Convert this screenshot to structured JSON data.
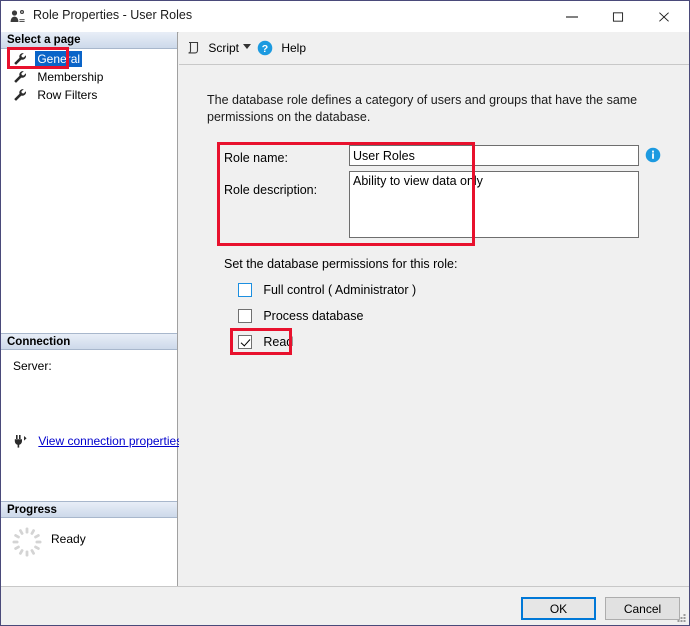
{
  "window": {
    "title": "Role Properties - User Roles",
    "icon": "role-users-icon",
    "controls": {
      "minimize": "minimize-icon",
      "maximize": "maximize-icon",
      "close": "close-icon"
    }
  },
  "sidebar": {
    "sections": {
      "select_page": "Select a page",
      "connection": "Connection",
      "progress": "Progress"
    },
    "pages": [
      {
        "label": "General",
        "icon": "wrench-icon",
        "selected": true
      },
      {
        "label": "Membership",
        "icon": "wrench-icon",
        "selected": false
      },
      {
        "label": "Row Filters",
        "icon": "wrench-icon",
        "selected": false
      }
    ],
    "connection": {
      "server_label": "Server:",
      "server_value": "",
      "link_label": "View connection properties",
      "link_icon": "plug-icon"
    },
    "progress": {
      "status": "Ready",
      "icon": "spinner-icon"
    }
  },
  "toolbar": {
    "script_label": "Script",
    "script_icon": "script-icon",
    "script_caret": "chevron-down-icon",
    "help_label": "Help",
    "help_icon": "help-question-icon"
  },
  "main": {
    "description": "The database role defines a category of users and groups that have the same permissions on the database.",
    "fields": {
      "role_name_label": "Role name:",
      "role_name_value": "User Roles",
      "role_name_placeholder": "",
      "role_description_label": "Role description:",
      "role_description_value": "Ability to view data only",
      "role_description_placeholder": "",
      "info_icon": "info-icon"
    },
    "permissions": {
      "title": "Set the database permissions for this role:",
      "items": [
        {
          "label": "Full control ( Administrator )",
          "checked": false,
          "focused": true
        },
        {
          "label": "Process database",
          "checked": false,
          "focused": false
        },
        {
          "label": "Read",
          "checked": true,
          "focused": false
        }
      ]
    }
  },
  "footer": {
    "ok_label": "OK",
    "cancel_label": "Cancel",
    "resize_grip": "resize-grip-icon"
  },
  "colors": {
    "highlight_red": "#e8112d",
    "selection_blue": "#0a64c8",
    "focus_blue": "#0078d7",
    "link_blue": "#0000cd",
    "info_blue": "#1c9ae0"
  }
}
